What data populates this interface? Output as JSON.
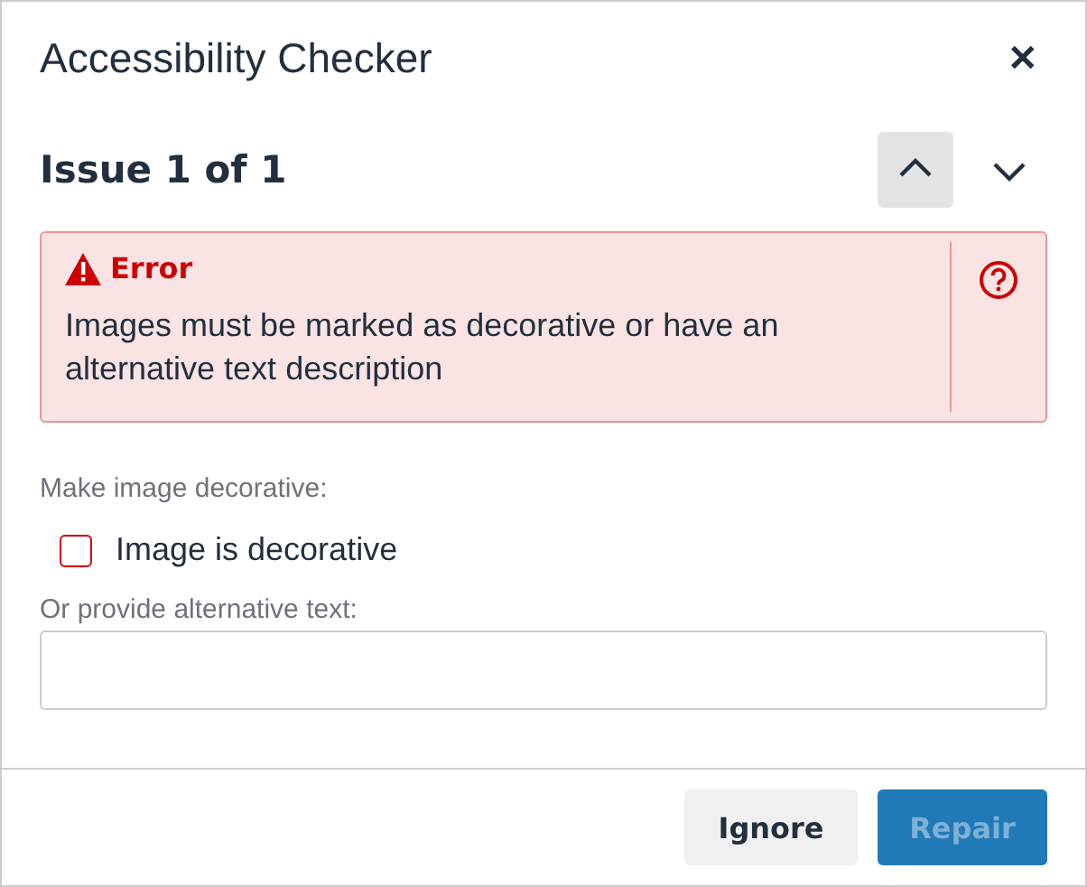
{
  "dialog": {
    "title": "Accessibility Checker",
    "close": "✕"
  },
  "issue": {
    "heading": "Issue 1 of 1",
    "nav": [
      {
        "kind": "up",
        "highlighted": true
      },
      {
        "kind": "down",
        "highlighted": false
      }
    ]
  },
  "alert": {
    "kind": "error",
    "label": "Error",
    "message": "Images must be marked as decorative or have an alternative text description"
  },
  "decorative": {
    "label": "Make image decorative:",
    "checkbox": {
      "label": "Image is decorative",
      "checked": false
    }
  },
  "alt_text": {
    "label": "Or provide alternative text:"
  },
  "buttons": [
    {
      "label": "Ignore",
      "kind": "secondary",
      "disabled": false
    },
    {
      "label": "Repair",
      "kind": "primary",
      "disabled": true
    }
  ]
}
